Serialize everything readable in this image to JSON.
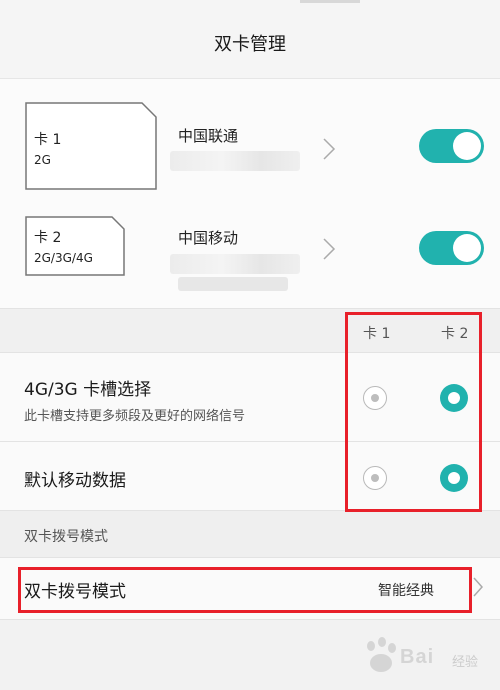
{
  "header": {
    "title": "双卡管理"
  },
  "sims": [
    {
      "name": "卡 1",
      "network": "2G",
      "carrier": "中国联通",
      "enabled": true
    },
    {
      "name": "卡 2",
      "network": "2G/3G/4G",
      "carrier": "中国移动",
      "enabled": true
    }
  ],
  "columns": {
    "card1": "卡 1",
    "card2": "卡 2"
  },
  "options": [
    {
      "title": "4G/3G 卡槽选择",
      "subtitle": "此卡槽支持更多频段及更好的网络信号",
      "selected": "卡 2"
    },
    {
      "title": "默认移动数据",
      "selected": "卡 2"
    }
  ],
  "dial_section": {
    "label": "双卡拨号模式",
    "row_title": "双卡拨号模式",
    "value": "智能经典"
  },
  "colors": {
    "accent": "#21b2ae",
    "annotation": "#e8202a"
  },
  "watermark": {
    "text": "Bai",
    "suffix": "经验"
  }
}
